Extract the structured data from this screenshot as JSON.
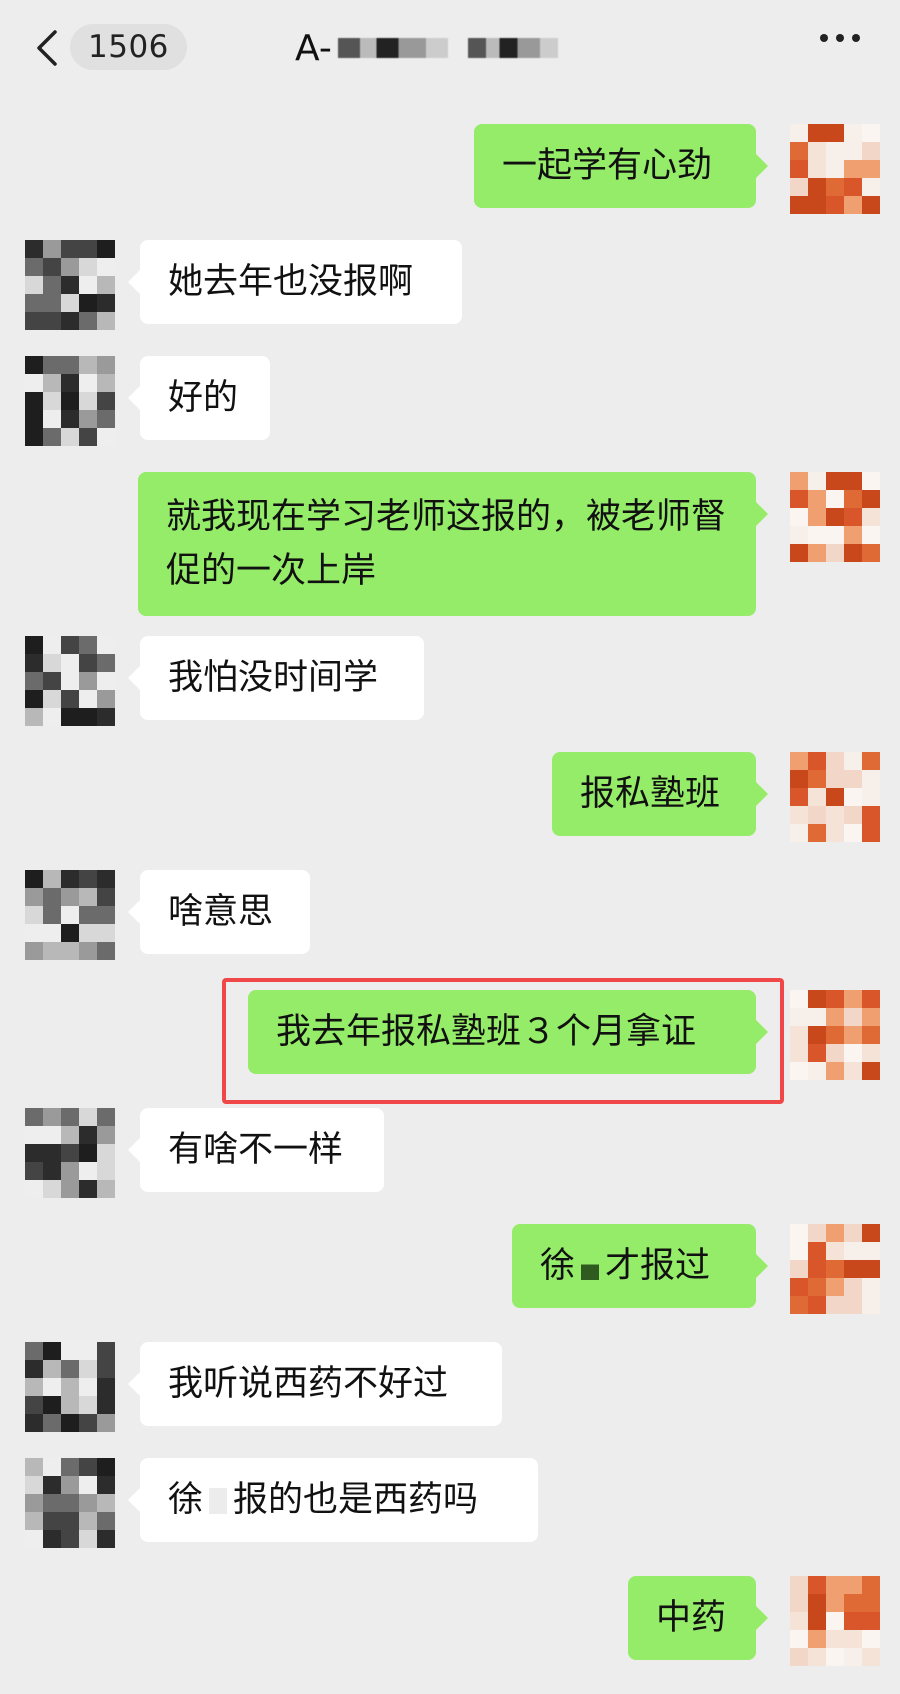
{
  "header": {
    "back_icon": "chevron-left-icon",
    "unread_count": "1506",
    "title_visible": "A-",
    "more_icon": "more-dots-icon"
  },
  "messages": [
    {
      "side": "out",
      "text": "一起学有心劲"
    },
    {
      "side": "in",
      "text": "她去年也没报啊"
    },
    {
      "side": "in",
      "text": "好的"
    },
    {
      "side": "out",
      "text": "就我现在学习老师这报的，被老师督促的一次上岸"
    },
    {
      "side": "in",
      "text": "我怕没时间学"
    },
    {
      "side": "out",
      "text": "报私塾班"
    },
    {
      "side": "in",
      "text": "啥意思"
    },
    {
      "side": "out",
      "text": "我去年报私塾班３个月拿证",
      "highlighted": true
    },
    {
      "side": "in",
      "text": "有啥不一样"
    },
    {
      "side": "out",
      "text_parts": [
        "徐",
        "才报过"
      ]
    },
    {
      "side": "in",
      "text": "我听说西药不好过"
    },
    {
      "side": "in",
      "text_parts": [
        "徐",
        "报的也是西药吗"
      ]
    },
    {
      "side": "out",
      "text": "中药"
    }
  ],
  "colors": {
    "background": "#ededed",
    "outgoing_bubble": "#95ec69",
    "incoming_bubble": "#ffffff",
    "highlight_border": "#f04848"
  }
}
